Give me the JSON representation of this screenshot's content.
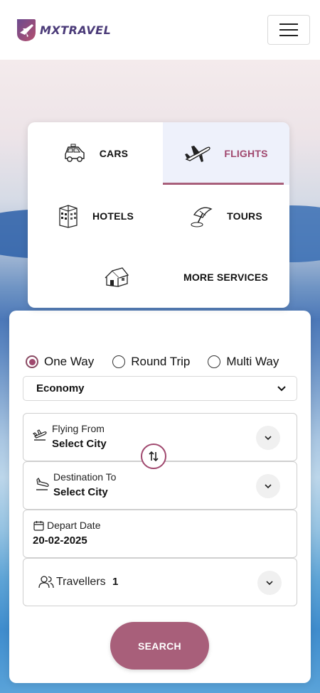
{
  "brand": {
    "name": "MXTRAVEL"
  },
  "services": [
    {
      "label": "CARS",
      "icon": "car-icon",
      "active": false
    },
    {
      "label": "FLIGHTS",
      "icon": "airplane-icon",
      "active": true
    },
    {
      "label": "HOTELS",
      "icon": "hotel-icon",
      "active": false
    },
    {
      "label": "TOURS",
      "icon": "tour-umbrella-icon",
      "active": false
    },
    {
      "label": "MORE SERVICES",
      "icon": "house-icon",
      "active": false
    }
  ],
  "trip_types": [
    {
      "label": "One Way",
      "checked": true
    },
    {
      "label": "Round Trip",
      "checked": false
    },
    {
      "label": "Multi Way",
      "checked": false
    }
  ],
  "cabin_class": {
    "selected": "Economy"
  },
  "flying_from": {
    "label": "Flying From",
    "value": "Select City"
  },
  "destination": {
    "label": "Destination To",
    "value": "Select City"
  },
  "depart_date": {
    "label": "Depart Date",
    "value": "20-02-2025"
  },
  "travellers": {
    "label": "Travellers",
    "count": "1"
  },
  "search_button": {
    "label": "SEARCH"
  },
  "colors": {
    "accent": "#a85f7a",
    "brand": "#4a3a78",
    "active_tab_bg": "#eef1fb"
  }
}
